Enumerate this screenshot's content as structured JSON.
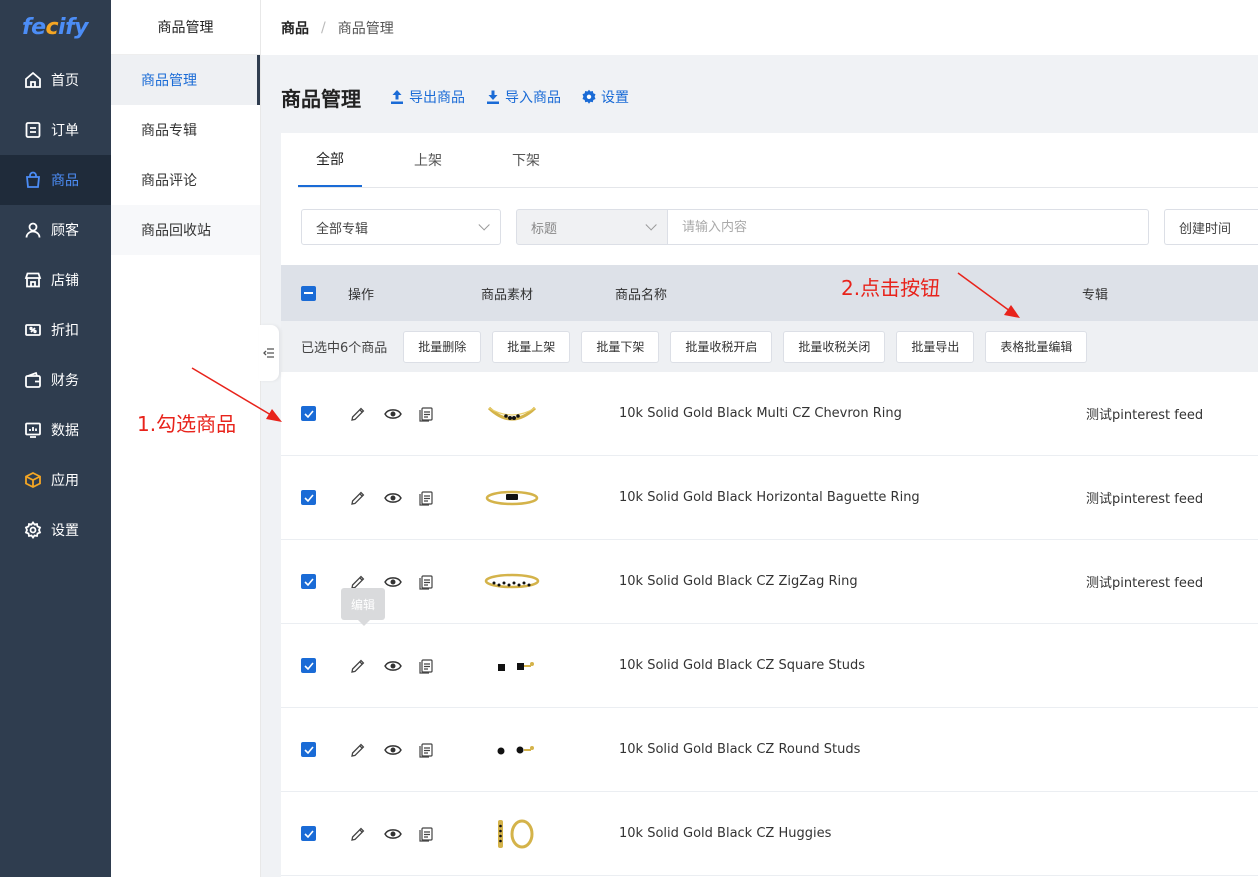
{
  "app": {
    "logo_pre": "fe",
    "logo_o": "c",
    "logo_post": "ify"
  },
  "nav": {
    "items": [
      {
        "label": "首页",
        "icon": "home-icon"
      },
      {
        "label": "订单",
        "icon": "order-icon"
      },
      {
        "label": "商品",
        "icon": "bag-icon",
        "active": true
      },
      {
        "label": "顾客",
        "icon": "user-icon"
      },
      {
        "label": "店铺",
        "icon": "store-icon"
      },
      {
        "label": "折扣",
        "icon": "discount-icon"
      },
      {
        "label": "财务",
        "icon": "wallet-icon"
      },
      {
        "label": "数据",
        "icon": "chart-icon"
      },
      {
        "label": "应用",
        "icon": "app-box-icon"
      },
      {
        "label": "设置",
        "icon": "gear-icon"
      }
    ]
  },
  "subnav": {
    "title": "商品管理",
    "items": [
      {
        "label": "商品管理",
        "active": true
      },
      {
        "label": "商品专辑"
      },
      {
        "label": "商品评论"
      },
      {
        "label": "商品回收站"
      }
    ]
  },
  "breadcrumb": {
    "root": "商品",
    "sep": "/",
    "current": "商品管理"
  },
  "header": {
    "title": "商品管理",
    "export_label": "导出商品",
    "import_label": "导入商品",
    "settings_label": "设置"
  },
  "tabs": [
    {
      "label": "全部",
      "active": true
    },
    {
      "label": "上架"
    },
    {
      "label": "下架"
    }
  ],
  "filters": {
    "album_select": "全部专辑",
    "field_select": "标题",
    "search_placeholder": "请输入内容",
    "sort_select": "创建时间"
  },
  "table": {
    "columns": {
      "action": "操作",
      "media": "商品素材",
      "name": "商品名称",
      "album": "专辑"
    },
    "bulk": {
      "selected_text": "已选中6个商品",
      "buttons": [
        "批量删除",
        "批量上架",
        "批量下架",
        "批量收税开启",
        "批量收税关闭",
        "批量导出",
        "表格批量编辑"
      ]
    },
    "rows": [
      {
        "name": "10k Solid Gold Black Multi CZ Chevron Ring",
        "album": "测试pinterest feed",
        "checked": true
      },
      {
        "name": "10k Solid Gold Black Horizontal Baguette Ring",
        "album": "测试pinterest feed",
        "checked": true
      },
      {
        "name": "10k Solid Gold Black CZ ZigZag Ring",
        "album": "测试pinterest feed",
        "checked": true
      },
      {
        "name": "10k Solid Gold Black CZ Square Studs",
        "album": "",
        "checked": true
      },
      {
        "name": "10k Solid Gold Black CZ Round Studs",
        "album": "",
        "checked": true
      },
      {
        "name": "10k Solid Gold Black CZ Huggies",
        "album": "",
        "checked": true
      }
    ]
  },
  "tooltip": {
    "text": "编辑"
  },
  "annotations": {
    "step1": "1.勾选商品",
    "step2": "2.点击按钮",
    "color": "#e8231b"
  },
  "colors": {
    "accent": "#1a6bd6",
    "sidebar": "#2f3d4f"
  }
}
